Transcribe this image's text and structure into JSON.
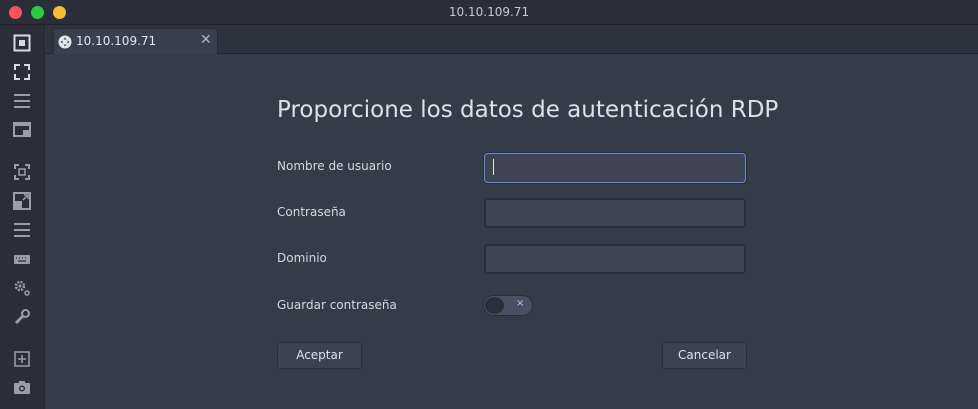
{
  "window": {
    "title": "10.10.109.71"
  },
  "tab": {
    "label": "10.10.109.71",
    "close_glyph": "✕"
  },
  "dialog": {
    "heading": "Proporcione los datos de autenticación RDP",
    "username_label": "Nombre de usuario",
    "username_value": "",
    "password_label": "Contraseña",
    "password_value": "",
    "domain_label": "Dominio",
    "domain_value": "",
    "save_password_label": "Guardar contraseña",
    "save_password_on": false,
    "switch_glyph": "×",
    "accept_label": "Aceptar",
    "cancel_label": "Cancelar"
  },
  "toolbar_icons": [
    "fit-window-icon",
    "fullscreen-icon",
    "menu-icon",
    "screenshot-window-icon",
    "scale-icon",
    "resize-icon",
    "list-icon",
    "keyboard-icon",
    "preferences-icon",
    "tools-icon",
    "new-connection-icon",
    "camera-icon"
  ],
  "colors": {
    "close": "#f2555a",
    "minimize": "#2acb42",
    "maximize": "#f5be30",
    "focus_border": "#5f8fd8",
    "background": "#363b48"
  }
}
